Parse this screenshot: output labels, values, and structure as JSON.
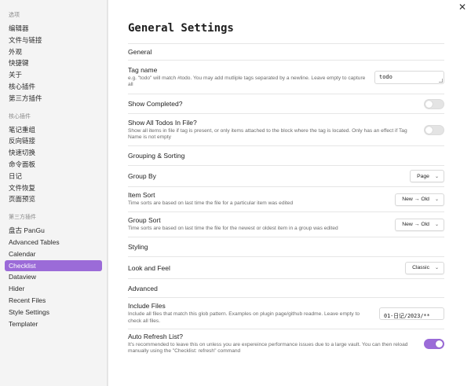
{
  "close_glyph": "✕",
  "sidebar": {
    "groups": [
      {
        "heading": "选项",
        "items": [
          "编辑器",
          "文件与链接",
          "外观",
          "快捷键",
          "关于",
          "核心插件",
          "第三方插件"
        ]
      },
      {
        "heading": "核心插件",
        "items": [
          "笔记重组",
          "反向链接",
          "快速切换",
          "命令面板",
          "日记",
          "文件恢复",
          "页面预览"
        ]
      },
      {
        "heading": "第三方插件",
        "items": [
          "盘古 PanGu",
          "Advanced Tables",
          "Calendar",
          "Checklist",
          "Dataview",
          "Hider",
          "Recent Files",
          "Style Settings",
          "Templater"
        ]
      }
    ],
    "active_item": "Checklist"
  },
  "main": {
    "title": "General Settings",
    "sections": {
      "general": "General",
      "grouping": "Grouping & Sorting",
      "styling": "Styling",
      "advanced": "Advanced"
    },
    "settings": {
      "tag_name": {
        "name": "Tag name",
        "desc": "e.g. \"todo\" will match #todo. You may add mutliple tags separated by a newline. Leave empty to capture all",
        "value": "todo"
      },
      "show_completed": {
        "name": "Show Completed?",
        "on": false
      },
      "show_all_todos": {
        "name": "Show All Todos In File?",
        "desc": "Show all items in file if tag is present, or only items attached to the block where the tag is located. Only has an effect if Tag Name is not empty",
        "on": false
      },
      "group_by": {
        "name": "Group By",
        "value": "Page"
      },
      "item_sort": {
        "name": "Item Sort",
        "desc": "Time sorts are based on last time the file for a particular item was edited",
        "value": "New → Old"
      },
      "group_sort": {
        "name": "Group Sort",
        "desc": "Time sorts are based on last time the file for the newest or oldest item in a group was edited",
        "value": "New → Old"
      },
      "look_and_feel": {
        "name": "Look and Feel",
        "value": "Classic"
      },
      "include_files": {
        "name": "Include Files",
        "desc": "Include all files that match this glob pattern. Examples on plugin page/github readme. Leave empty to check all files.",
        "value": "01-日记/2023/**"
      },
      "auto_refresh": {
        "name": "Auto Refresh List?",
        "desc": "It's recommended to leave this on unless you are expereince performance issues due to a large vault. You can then reload manually using the \"Checklist: refresh\" command",
        "on": true
      }
    },
    "chevron_glyph": "⌄"
  },
  "colors": {
    "accent": "#9b6bd8",
    "sidebar_bg": "#f4f4f4",
    "main_bg": "#ffffff"
  }
}
